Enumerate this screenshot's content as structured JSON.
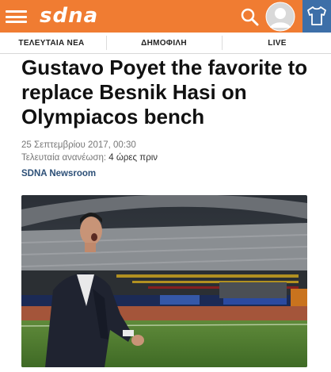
{
  "header": {
    "logo_text": "sdna",
    "icons": [
      "menu-icon",
      "search-icon",
      "user-avatar-icon",
      "jersey-icon"
    ],
    "brand_color": "#f07c32",
    "jersey_box_color": "#3d6fa8"
  },
  "tabs": [
    {
      "label": "ΤΕΛΕΥΤΑΙΑ ΝΕΑ"
    },
    {
      "label": "ΔΗΜΟΦΙΛΗ"
    },
    {
      "label": "LIVE"
    }
  ],
  "article": {
    "title": "Gustavo Poyet the favorite to replace Besnik Hasi on Olympiacos bench",
    "date": "25 Σεπτεμβρίου 2017, 00:30",
    "updated_label": "Τελευταία ανανέωση:",
    "updated_value": "4 ώρες πριν",
    "author": "SDNA Newsroom",
    "author_color": "#2c4f77"
  }
}
